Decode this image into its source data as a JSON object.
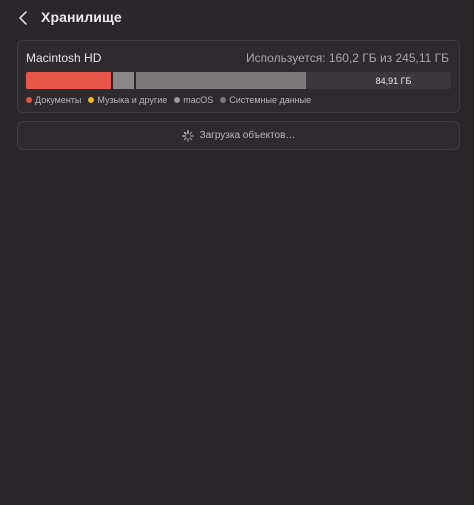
{
  "header": {
    "title": "Хранилище",
    "back_icon": "chevron-left-icon"
  },
  "disk": {
    "name": "Macintosh HD",
    "usage": "Используется: 160,2 ГБ из 245,11 ГБ",
    "free_label": "84,91 ГБ",
    "segments": [
      {
        "name": "Документы",
        "fraction": 0.2,
        "color": "#e6574a"
      },
      {
        "name": "macOS",
        "fraction": 0.05,
        "color": "#8a8788"
      },
      {
        "name": "Системные данные",
        "fraction": 0.4,
        "color": "#7d7a7b"
      }
    ],
    "legend": [
      {
        "label": "Документы",
        "color": "#e6574a"
      },
      {
        "label": "Музыка и другие",
        "color": "#f0b429"
      },
      {
        "label": "macOS",
        "color": "#9a9798"
      },
      {
        "label": "Системные данные",
        "color": "#7d7a7b"
      }
    ]
  },
  "loading": {
    "text": "Загрузка объектов…",
    "icon": "spinner-icon"
  }
}
